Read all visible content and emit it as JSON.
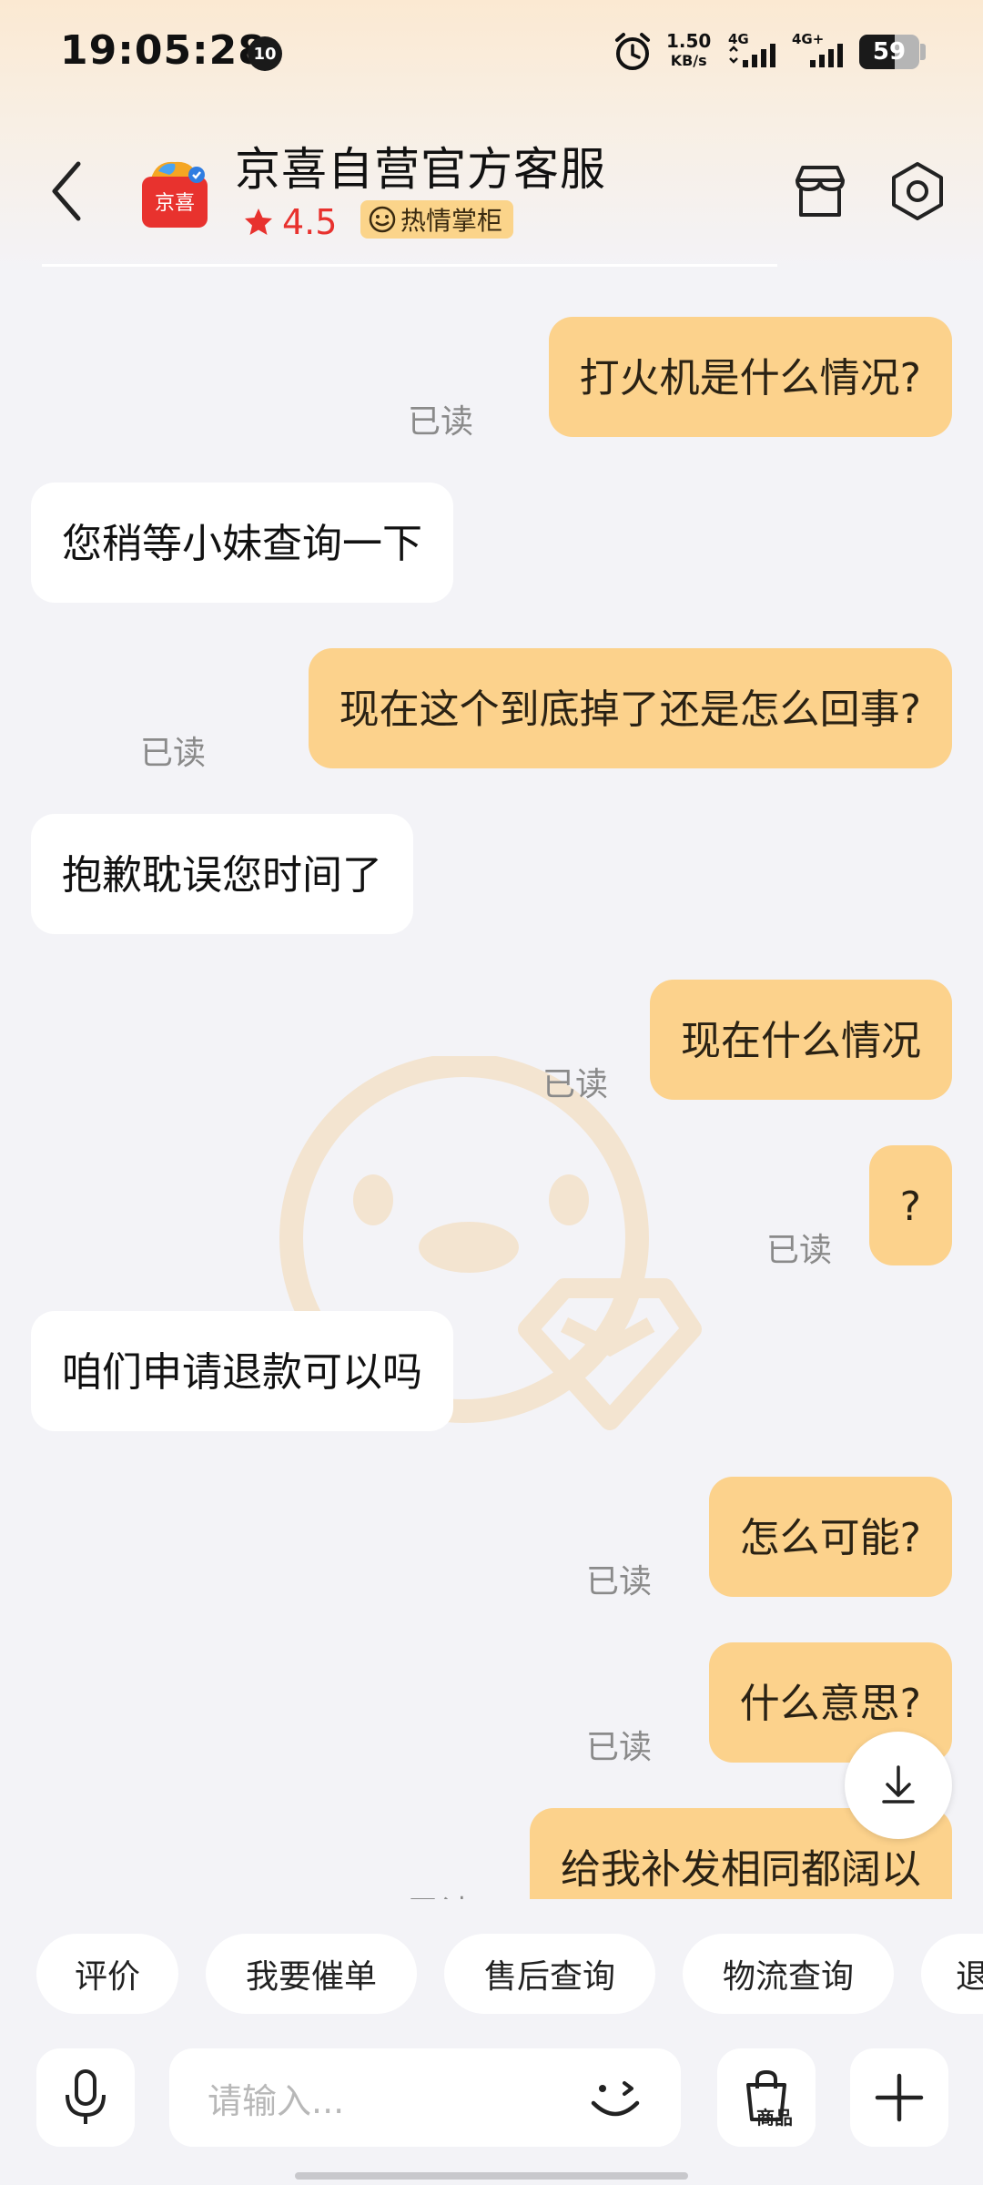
{
  "status_bar": {
    "time": "19:05:28",
    "notification_count": "10",
    "net_speed": "1.50",
    "net_speed_unit": "KB/s",
    "signal_1_label": "4G",
    "signal_2_label": "4G+",
    "battery_level": "59"
  },
  "header": {
    "shop_name": "京喜自营官方客服",
    "logo_text": "京喜",
    "rating": "4.5",
    "tag_label": "热情掌柜",
    "accent_color": "#e8322e",
    "tag_color": "#fbd48a"
  },
  "messages": [
    {
      "side": "out",
      "text": "打火机是什么情况?",
      "status": "已读"
    },
    {
      "side": "in",
      "text": "您稍等小妹查询一下"
    },
    {
      "side": "out",
      "text": "现在这个到底掉了还是怎么回事?",
      "status": "已读"
    },
    {
      "side": "in",
      "text": "抱歉耽误您时间了"
    },
    {
      "side": "out",
      "text": "现在什么情况",
      "status": "已读"
    },
    {
      "side": "out",
      "text": "?",
      "status": "已读"
    },
    {
      "side": "in",
      "text": "咱们申请退款可以吗"
    },
    {
      "side": "out",
      "text": "怎么可能?",
      "status": "已读"
    },
    {
      "side": "out",
      "text": "什么意思?",
      "status": "已读"
    },
    {
      "side": "out",
      "text": "给我补发相同都阔以",
      "status": "已读"
    }
  ],
  "quick_replies": [
    "评价",
    "我要催单",
    "售后查询",
    "物流查询",
    "退"
  ],
  "input": {
    "placeholder": "请输入...",
    "goods_label": "商品"
  },
  "colors": {
    "outgoing_bubble": "#fcd28c",
    "incoming_bubble": "#ffffff",
    "background": "#f3f3f7"
  }
}
